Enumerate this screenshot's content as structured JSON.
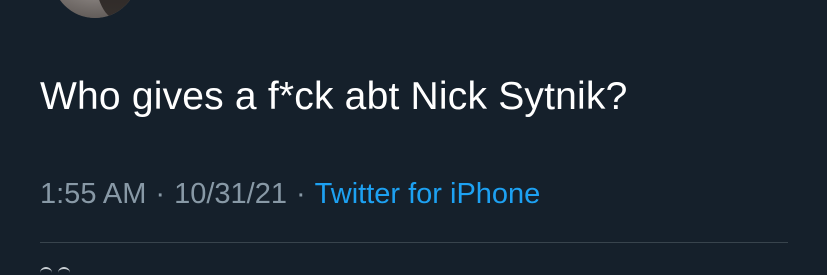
{
  "tweet": {
    "text": "Who gives a f*ck abt Nick Sytnik?",
    "time": "1:55 AM",
    "date": "10/31/21",
    "separator": "·",
    "source": "Twitter for iPhone"
  },
  "colors": {
    "background": "#15202b",
    "text": "#ffffff",
    "secondary_text": "#8899a6",
    "link": "#1da1f2",
    "divider": "#38444d"
  }
}
